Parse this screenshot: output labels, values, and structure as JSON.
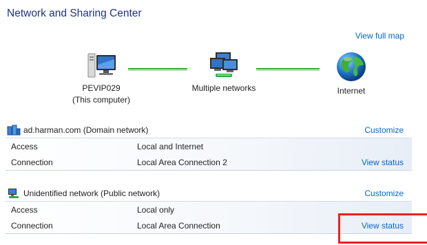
{
  "window": {
    "title": "Network and Sharing Center"
  },
  "map": {
    "view_full_map": "View full map",
    "computer": {
      "name": "PEVIP029",
      "sub": "(This computer)",
      "icon": "computer-icon"
    },
    "middle": {
      "name": "Multiple networks",
      "icon": "multiple-networks-icon"
    },
    "internet": {
      "name": "Internet",
      "icon": "globe-icon"
    },
    "line_color": "#2fa32f"
  },
  "networks": [
    {
      "name": "ad.harman.com (Domain network)",
      "icon": "domain-network-icon",
      "customize": "Customize",
      "rows": [
        {
          "key": "Access",
          "value": "Local and Internet",
          "action": ""
        },
        {
          "key": "Connection",
          "value": "Local Area Connection 2",
          "action": "View status"
        }
      ]
    },
    {
      "name": "Unidentified network (Public network)",
      "icon": "public-network-icon",
      "customize": "Customize",
      "rows": [
        {
          "key": "Access",
          "value": "Local only",
          "action": ""
        },
        {
          "key": "Connection",
          "value": "Local Area Connection",
          "action": "View status"
        }
      ]
    }
  ],
  "colors": {
    "title": "#1e3287",
    "link": "#0066cc",
    "highlight": "#e8231a"
  }
}
